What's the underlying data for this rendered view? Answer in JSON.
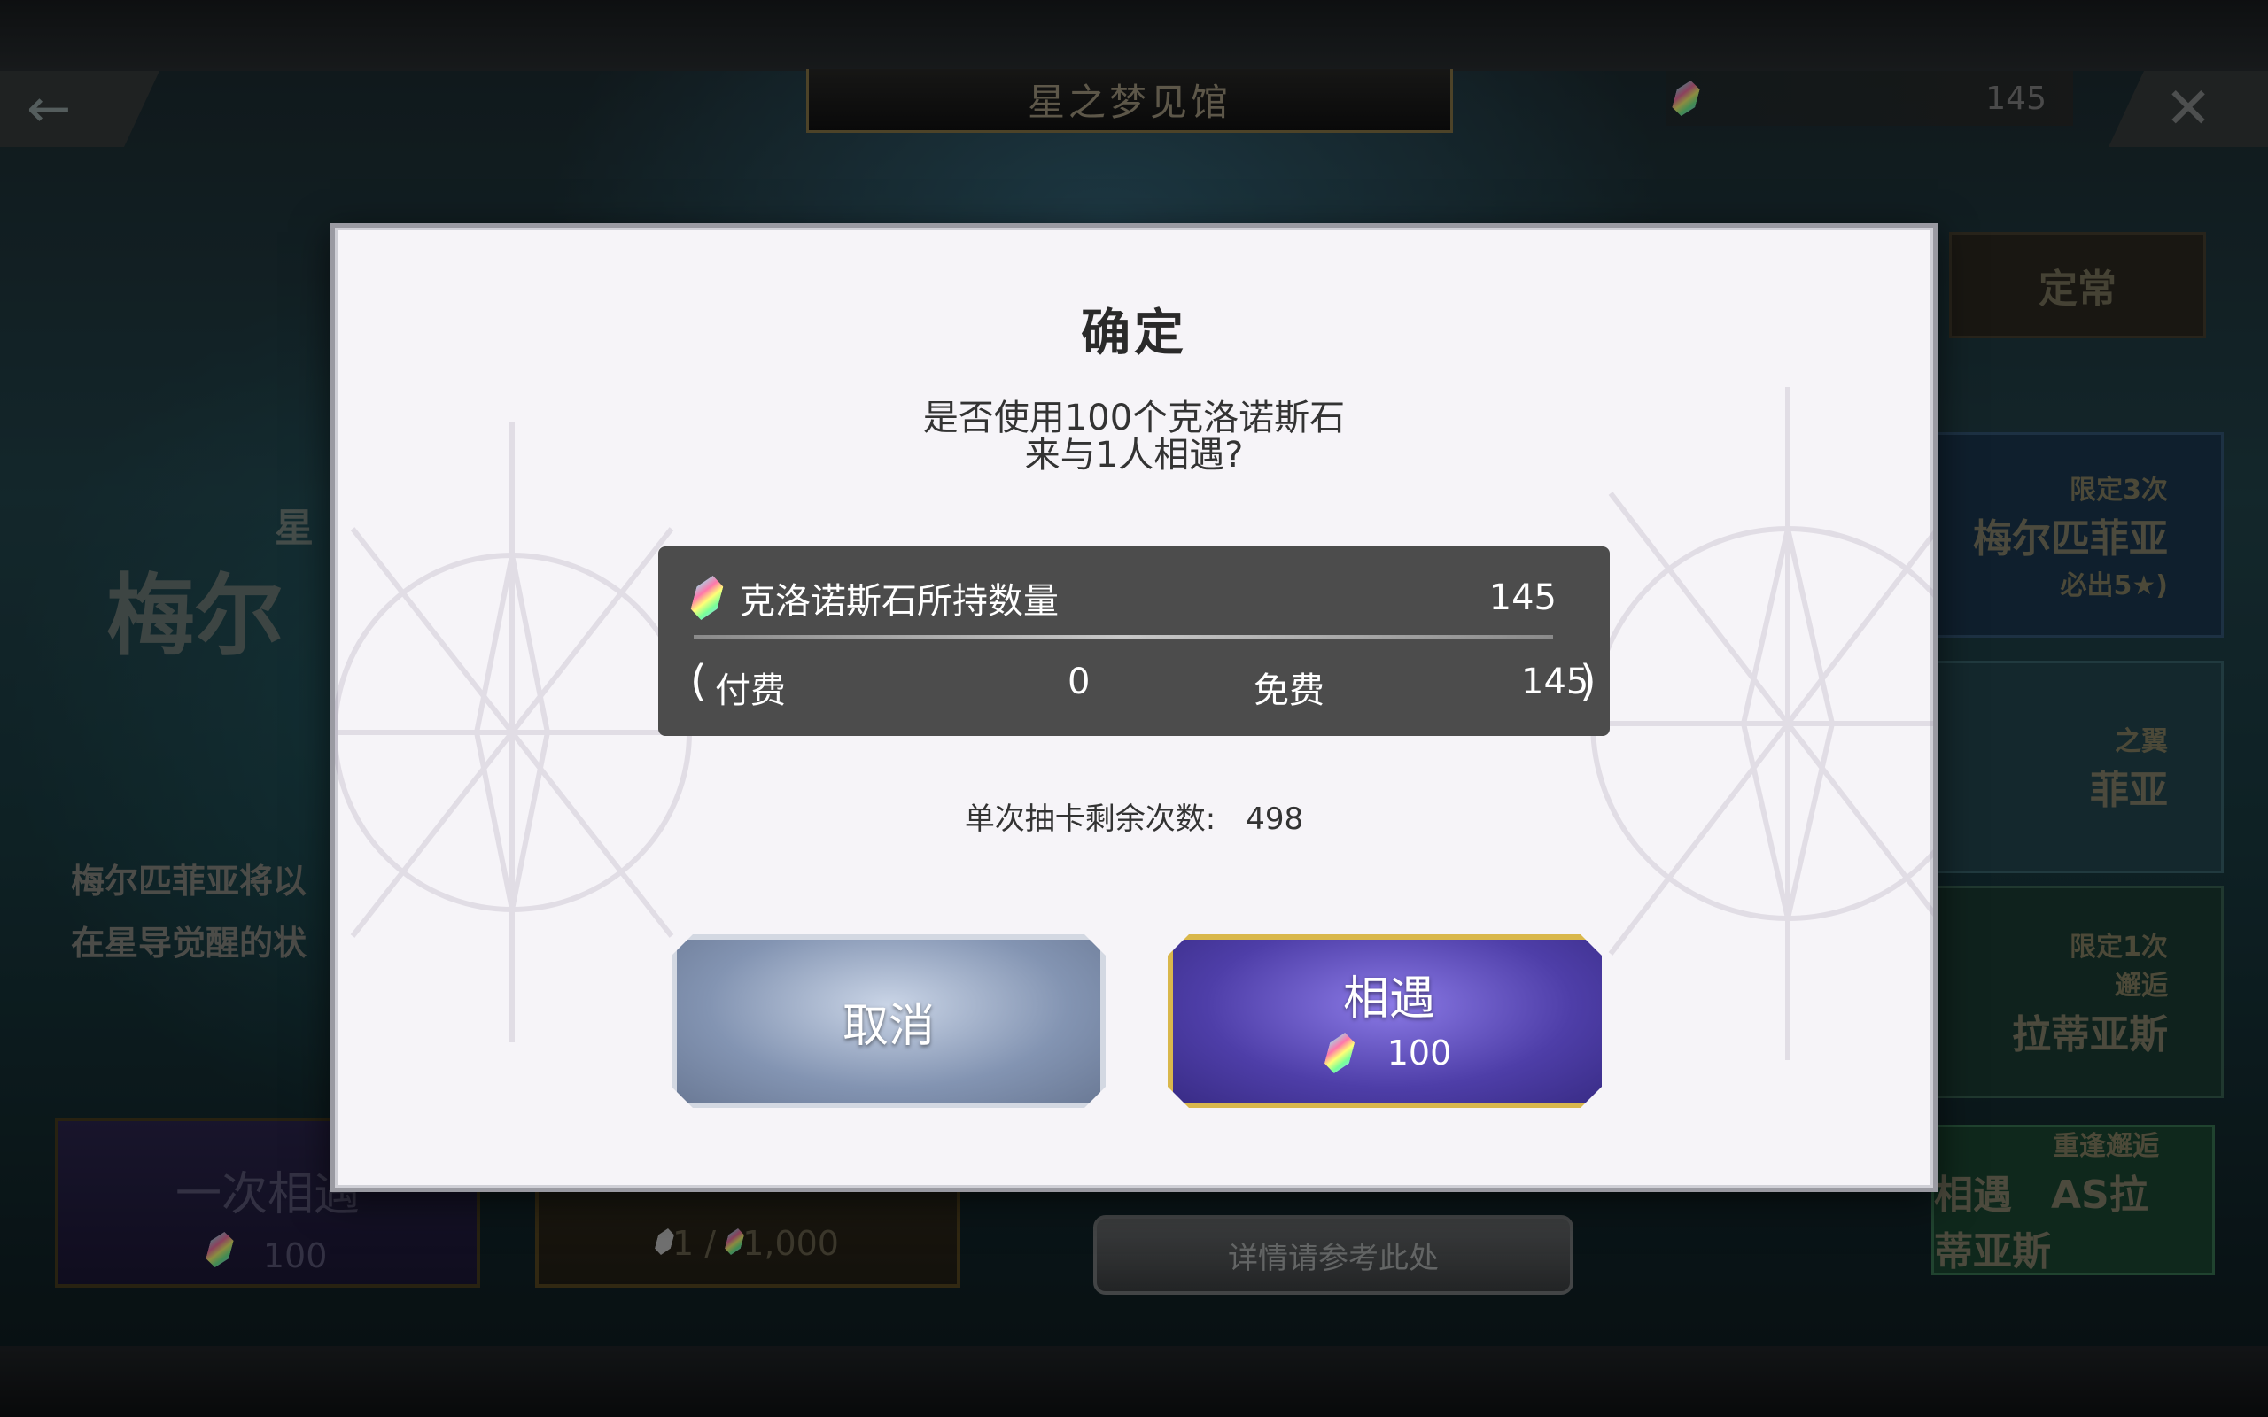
{
  "header": {
    "title": "星之梦见馆",
    "currency_amount": "145",
    "back_icon": "back-arrow-icon",
    "close_icon": "close-icon"
  },
  "side_tabs": {
    "regular": "定常",
    "limited_a_small": "限定3次",
    "limited_a_big": "梅尔匹菲亚",
    "limited_a_note": "必出5★)",
    "b_small": "之翼",
    "b_big": "菲亚",
    "limited_c_small": "限定1次",
    "c_sub": "邂逅",
    "c_big": "拉蒂亚斯",
    "d_small": "重逢邂逅",
    "d_big": "相遇　AS拉蒂亚斯"
  },
  "banner": {
    "sub": "星",
    "name": "梅尔",
    "desc_line1": "梅尔匹菲亚将以",
    "desc_line2": "在星导觉醒的状"
  },
  "bottom": {
    "pull1_title": "一次相遇",
    "pull1_cost": "100",
    "pull10_cost_a": "1",
    "pull10_sep": "/",
    "pull10_cost_b": "1,000",
    "details": "详情请参考此处"
  },
  "modal": {
    "title": "确定",
    "message_line1": "是否使用100个克洛诺斯石",
    "message_line2": "来与1人相遇?",
    "holdings_label": "克洛诺斯石所持数量",
    "holdings_value": "145",
    "open_paren": "(",
    "paid_label": "付费",
    "paid_value": "0",
    "free_label": "免费",
    "free_value": "145",
    "close_paren": ")",
    "remaining_label": "单次抽卡剩余次数:",
    "remaining_value": "498",
    "cancel_label": "取消",
    "meet_label": "相遇",
    "meet_cost": "100"
  },
  "colors": {
    "modal_bg": "#f6f4f8",
    "panel_bg": "#4c4c4c",
    "meet_border": "#d9b74c",
    "meet_fill": "#4e3ea8",
    "cancel_fill": "#8394b2"
  }
}
